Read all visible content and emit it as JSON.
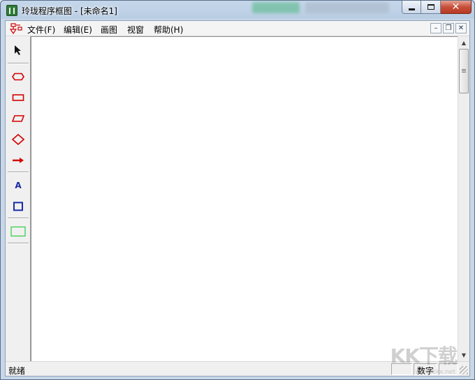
{
  "window": {
    "title": "玲珑程序框图 - [未命名1]"
  },
  "menu": {
    "items": [
      "文件(F)",
      "编辑(E)",
      "画图",
      "视窗",
      "帮助(H)"
    ]
  },
  "toolbox": {
    "tools": [
      {
        "name": "pointer-tool",
        "icon": "arrow-pointer-icon"
      },
      {
        "name": "terminal-shape-tool",
        "icon": "rounded-hexagon-icon"
      },
      {
        "name": "process-shape-tool",
        "icon": "rectangle-icon"
      },
      {
        "name": "io-shape-tool",
        "icon": "parallelogram-icon"
      },
      {
        "name": "decision-shape-tool",
        "icon": "diamond-icon"
      },
      {
        "name": "arrow-tool",
        "icon": "arrow-right-icon"
      },
      {
        "name": "text-tool",
        "label": "A"
      },
      {
        "name": "box-tool",
        "icon": "blue-square-icon"
      },
      {
        "name": "area-tool",
        "icon": "green-rectangle-icon"
      }
    ]
  },
  "status": {
    "text": "就绪",
    "num_indicator": "数字"
  },
  "watermark": {
    "brand": "KK下载",
    "url": "www.kkx.net"
  },
  "colors": {
    "shape_red": "#d40000",
    "text_blue": "#1a2aa8",
    "area_green": "#2ecc40"
  }
}
